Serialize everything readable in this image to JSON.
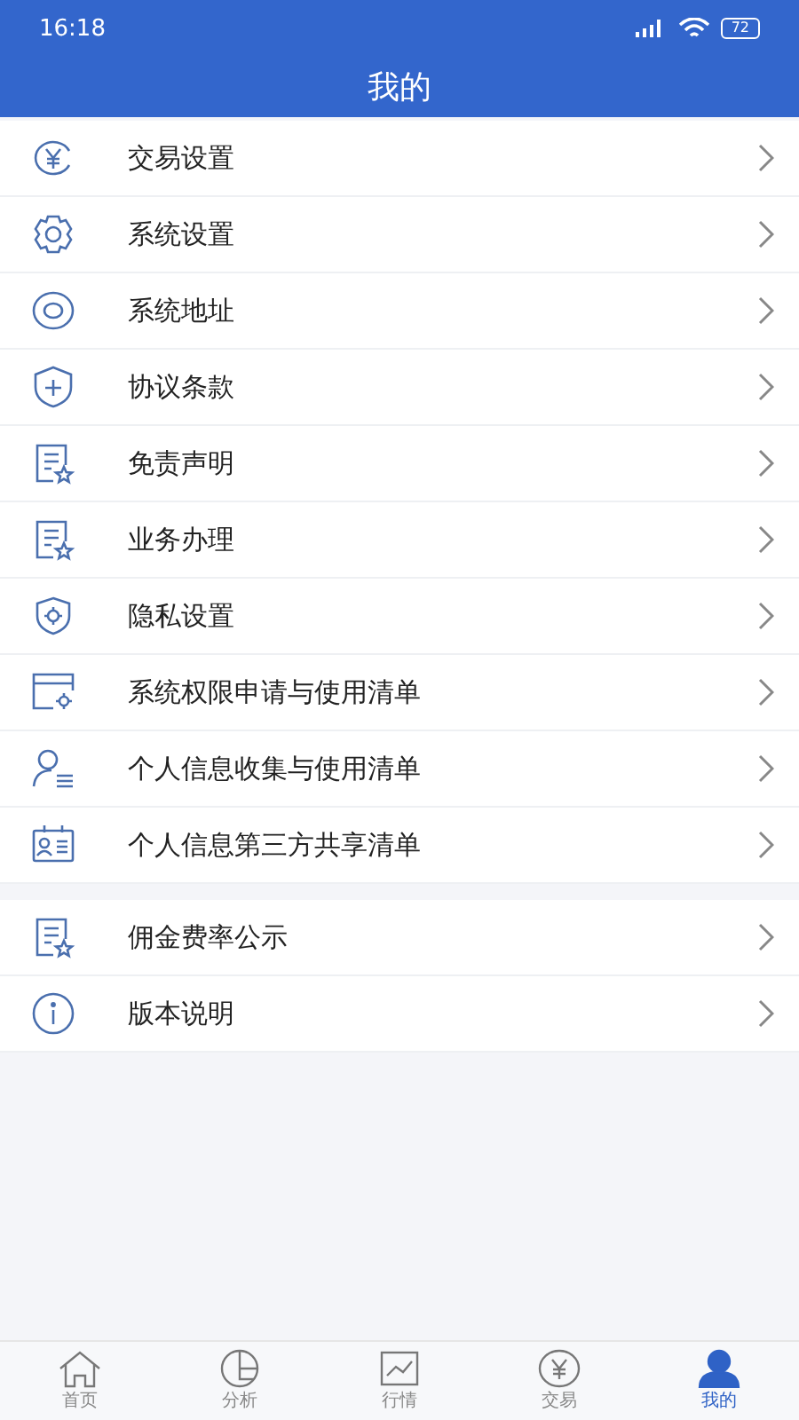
{
  "status_bar": {
    "time": "16:18",
    "battery": "72"
  },
  "header": {
    "title": "我的"
  },
  "groups": [
    {
      "items": [
        {
          "label": "交易设置",
          "kind": "yen"
        },
        {
          "label": "系统设置",
          "kind": "gear"
        },
        {
          "label": "系统地址",
          "kind": "location"
        },
        {
          "label": "协议条款",
          "kind": "shield"
        },
        {
          "label": "免责声明",
          "kind": "doc"
        },
        {
          "label": "业务办理",
          "kind": "doc"
        },
        {
          "label": "隐私设置",
          "kind": "shieldgear"
        },
        {
          "label": "系统权限申请与使用清单",
          "kind": "window"
        },
        {
          "label": "个人信息收集与使用清单",
          "kind": "person"
        },
        {
          "label": "个人信息第三方共享清单",
          "kind": "card"
        }
      ]
    },
    {
      "items": [
        {
          "label": "佣金费率公示",
          "kind": "doc"
        },
        {
          "label": "版本说明",
          "kind": "info"
        }
      ]
    }
  ],
  "tab_bar": [
    {
      "label": "首页",
      "kind": "home",
      "selected": false
    },
    {
      "label": "分析",
      "kind": "pie",
      "selected": false
    },
    {
      "label": "行情",
      "kind": "chart",
      "selected": false
    },
    {
      "label": "交易",
      "kind": "yen",
      "selected": false
    },
    {
      "label": "我的",
      "kind": "person",
      "selected": true
    }
  ]
}
